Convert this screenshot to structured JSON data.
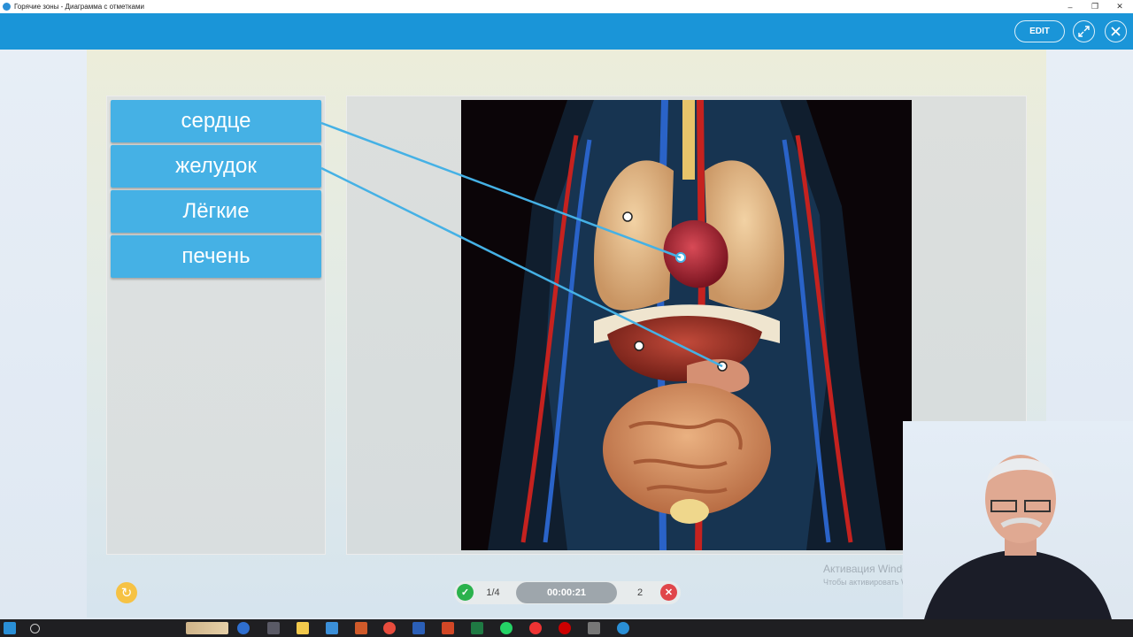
{
  "window": {
    "title": "Горячие зоны - Диаграмма с отметками",
    "minimize_glyph": "–",
    "restore_glyph": "❐",
    "close_glyph": "✕"
  },
  "toolbar": {
    "edit_label": "EDIT",
    "fullscreen_icon": "expand-icon",
    "close_icon": "close-icon",
    "accent_color": "#1a95d8"
  },
  "labels": [
    {
      "text": "сердце"
    },
    {
      "text": "желудок"
    },
    {
      "text": "Лёгкие"
    },
    {
      "text": "печень"
    }
  ],
  "label_color": "#45b1e5",
  "image": {
    "subject": "human-anatomy-torso-organs"
  },
  "status": {
    "correct_icon": "check-icon",
    "progress": "1/4",
    "timer": "00:00:21",
    "errors": "2",
    "error_icon": "x-icon",
    "refresh_icon": "refresh-icon"
  },
  "watermark": {
    "line1": "Активация Windows",
    "line2": "Чтобы активировать Windows"
  }
}
